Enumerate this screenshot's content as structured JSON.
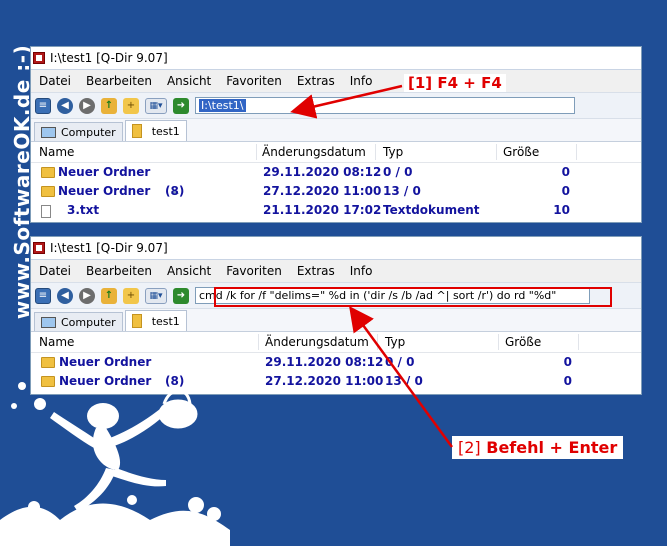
{
  "side_watermark": "www.SoftwareOK.de :-)",
  "window1": {
    "title": "I:\\test1  [Q-Dir 9.07]",
    "menu": [
      "Datei",
      "Bearbeiten",
      "Ansicht",
      "Favoriten",
      "Extras",
      "Info"
    ],
    "address": "I:\\test1\\",
    "tabs": [
      "Computer",
      "test1"
    ],
    "columns": [
      "Name",
      "Änderungsdatum",
      "Typ",
      "Größe"
    ],
    "rows": [
      {
        "name": "Neuer Ordner",
        "extra": "",
        "date": "29.11.2020 08:12",
        "type": "0 / 0",
        "size": "0"
      },
      {
        "name": "Neuer Ordner",
        "extra": "(8)",
        "date": "27.12.2020 11:00",
        "type": "13 / 0",
        "size": "0"
      },
      {
        "name": "3.txt",
        "extra": "",
        "date": "21.11.2020 17:02",
        "type": "Textdokument",
        "size": "10"
      }
    ]
  },
  "window2": {
    "title": "I:\\test1  [Q-Dir 9.07]",
    "menu": [
      "Datei",
      "Bearbeiten",
      "Ansicht",
      "Favoriten",
      "Extras",
      "Info"
    ],
    "address": "cmd /k for /f \"delims=\" %d in ('dir /s /b /ad ^| sort /r') do rd \"%d\"",
    "tabs": [
      "Computer",
      "test1"
    ],
    "columns": [
      "Name",
      "Änderungsdatum",
      "Typ",
      "Größe"
    ],
    "rows": [
      {
        "name": "Neuer Ordner",
        "extra": "",
        "date": "29.11.2020 08:12",
        "type": "0 / 0",
        "size": "0"
      },
      {
        "name": "Neuer Ordner",
        "extra": "(8)",
        "date": "27.12.2020 11:00",
        "type": "13 / 0",
        "size": "0"
      }
    ]
  },
  "annotations": {
    "step1": "[1] F4 + F4",
    "step2_prefix": "[2]",
    "step2": "Befehl + Enter"
  },
  "colors": {
    "background": "#1f4e96",
    "annotation": "#e00000",
    "folder_text": "#13139e"
  }
}
